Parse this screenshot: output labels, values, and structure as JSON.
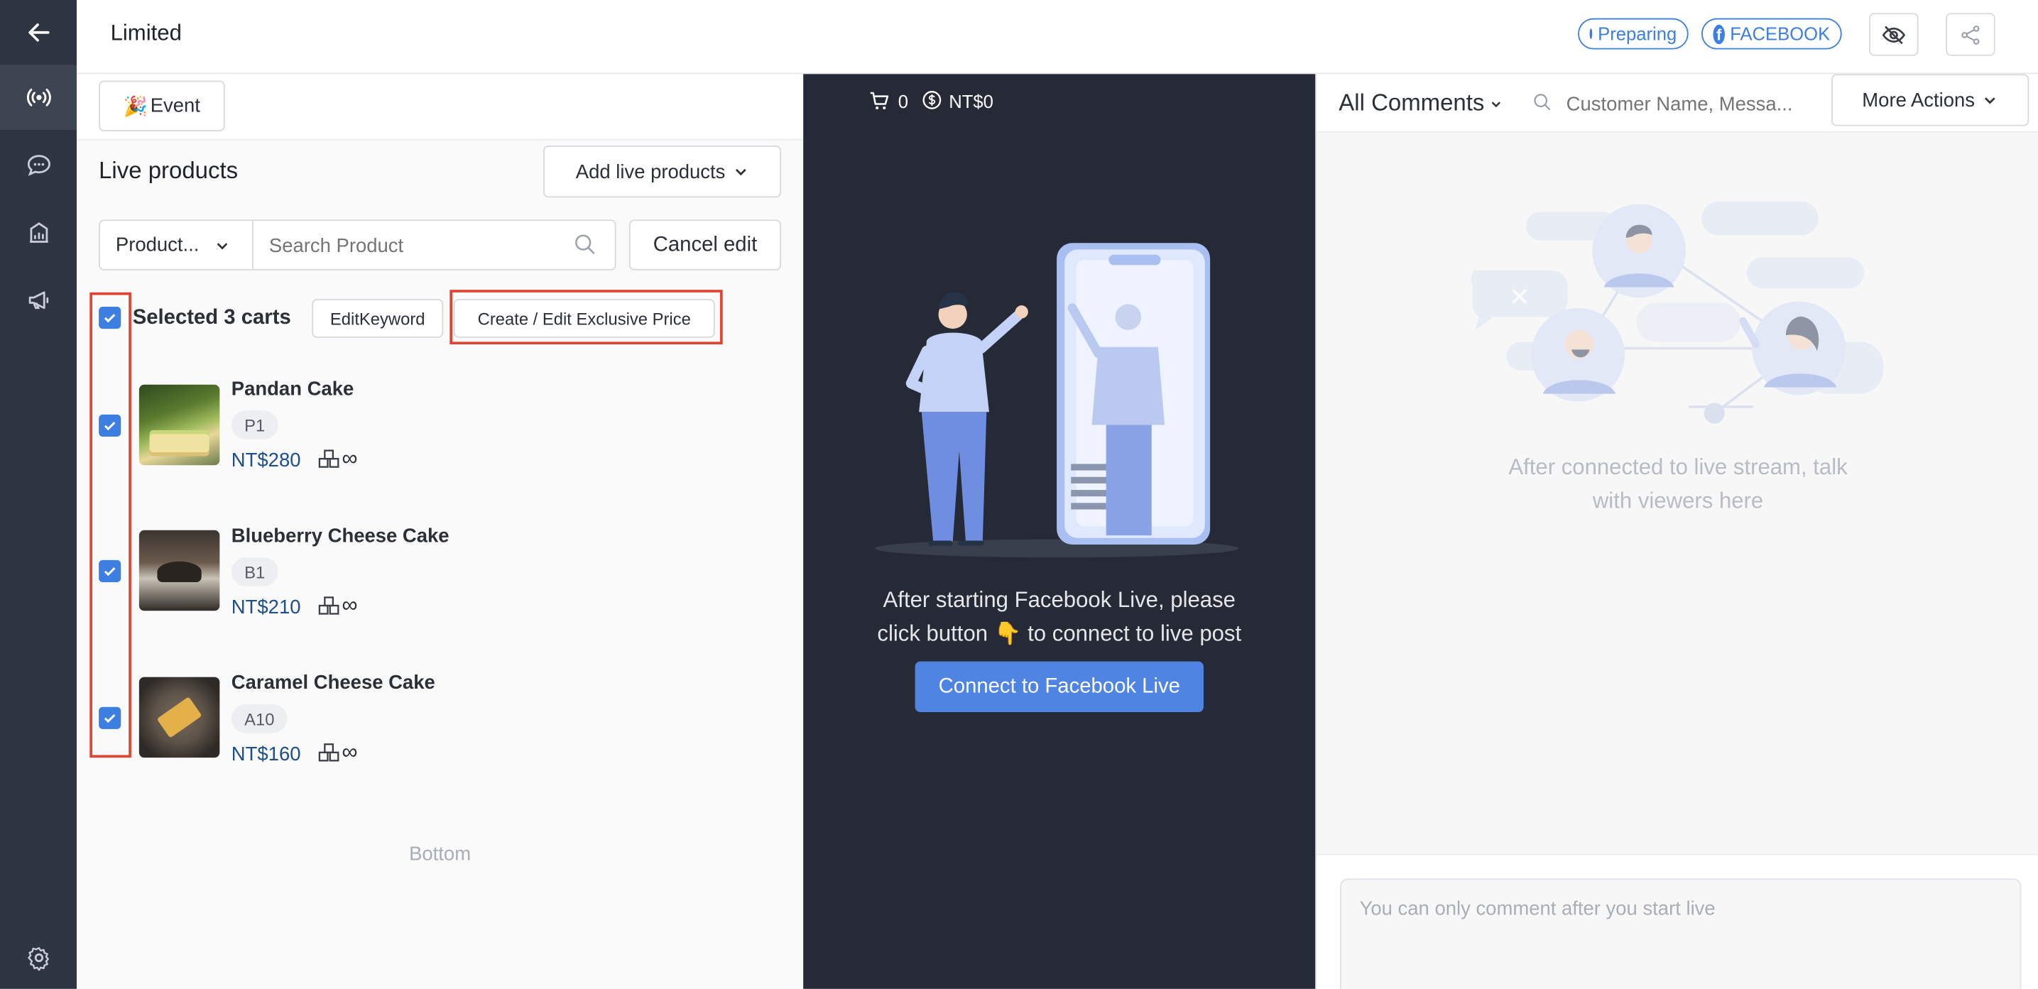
{
  "header": {
    "title": "Limited",
    "status_label": "Preparing",
    "platform_label": "FACEBOOK"
  },
  "left_panel": {
    "event_button": "Event",
    "section_title": "Live products",
    "add_button": "Add live products",
    "filter_select": "Product...",
    "search_placeholder": "Search Product",
    "cancel_button": "Cancel edit",
    "selected_label": "Selected 3 carts",
    "edit_keyword_button": "EditKeyword",
    "exclusive_price_button": "Create / Edit Exclusive Price",
    "products": [
      {
        "name": "Pandan Cake",
        "code": "P1",
        "price": "NT$280",
        "stock": "∞"
      },
      {
        "name": "Blueberry Cheese Cake",
        "code": "B1",
        "price": "NT$210",
        "stock": "∞"
      },
      {
        "name": "Caramel Cheese Cake",
        "code": "A10",
        "price": "NT$160",
        "stock": "∞"
      }
    ],
    "bottom_label": "Bottom"
  },
  "middle": {
    "cart_count": "0",
    "revenue": "NT$0",
    "instruction_line1": "After starting Facebook Live, please",
    "instruction_line2_a": "click button",
    "instruction_line2_b": "to connect to live post",
    "connect_button": "Connect to Facebook Live"
  },
  "right": {
    "comments_filter": "All Comments",
    "search_placeholder": "Customer Name, Messa...",
    "more_actions": "More Actions",
    "empty_line1": "After connected to live stream, talk",
    "empty_line2": "with viewers here",
    "comment_placeholder": "You can only comment after you start live"
  },
  "colors": {
    "accent": "#3d7fe0",
    "sidebar": "#2f3542",
    "stage": "#262a36",
    "highlight": "#e0432f"
  }
}
